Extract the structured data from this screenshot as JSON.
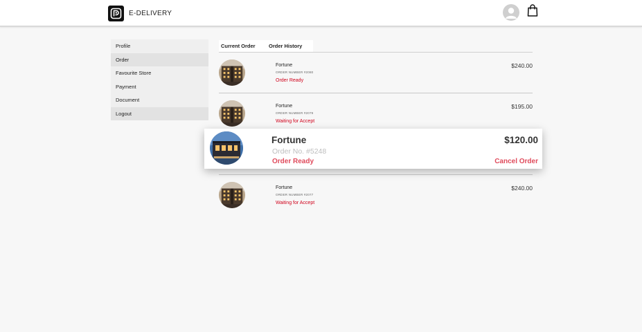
{
  "brand": {
    "name": "E-DELIVERY"
  },
  "header": {
    "avatar_icon": "user-avatar-icon",
    "bag_icon": "shopping-bag-icon"
  },
  "sidebar": {
    "items": [
      {
        "label": "Profile"
      },
      {
        "label": "Order"
      },
      {
        "label": "Favourite Store"
      },
      {
        "label": "Payment"
      },
      {
        "label": "Document"
      },
      {
        "label": "Logout"
      }
    ]
  },
  "tabs": [
    {
      "label": "Current Order"
    },
    {
      "label": "Order History"
    }
  ],
  "orders": [
    {
      "name": "Fortune",
      "number": "ORDER NUMBER #2080",
      "status": "Order Ready",
      "price": "$240.00"
    },
    {
      "name": "Fortune",
      "number": "ORDER NUMBER #2079",
      "status": "Waiting for Accept",
      "price": "$195.00"
    },
    {
      "name": "Fortune",
      "number": "ORDER NUMBER #2077",
      "status": "Waiting for Accept",
      "price": "$240.00"
    }
  ],
  "highlight_card": {
    "name": "Fortune",
    "number": "Order No. #5248",
    "status": "Order Ready",
    "price": "$120.00",
    "cancel_label": "Cancel Order"
  },
  "colors": {
    "accent": "#d9342b",
    "status_red": "#d0021b",
    "card_red": "#e04b5c"
  }
}
